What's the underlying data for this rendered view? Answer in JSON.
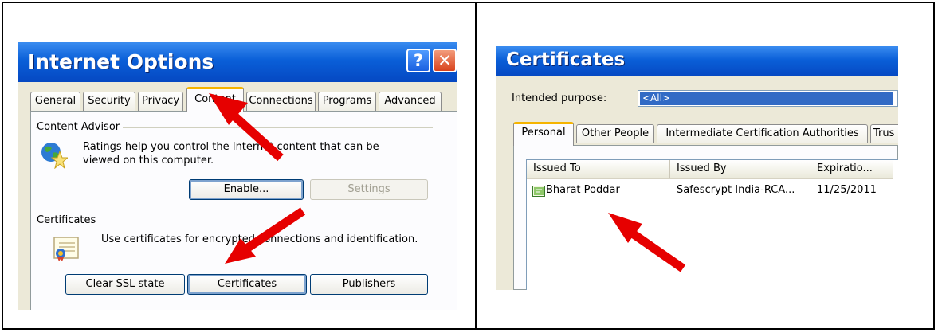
{
  "internet_options": {
    "title": "Internet Options",
    "help_glyph": "?",
    "close_glyph": "✕",
    "tabs": [
      "General",
      "Security",
      "Privacy",
      "Content",
      "Connections",
      "Programs",
      "Advanced"
    ],
    "active_tab": "Content",
    "content_advisor": {
      "group_label": "Content Advisor",
      "description_line1": "Ratings help you control the Internet content that can be",
      "description_line2": "viewed on this computer.",
      "enable_button": "Enable...",
      "settings_button": "Settings"
    },
    "certificates": {
      "group_label": "Certificates",
      "description": "Use certificates for encrypted connections and identification.",
      "clear_ssl_button": "Clear SSL state",
      "certificates_button": "Certificates",
      "publishers_button": "Publishers"
    }
  },
  "certificates_dialog": {
    "title": "Certificates",
    "intended_purpose_label": "Intended purpose:",
    "intended_purpose_value": "<All>",
    "tabs": [
      "Personal",
      "Other People",
      "Intermediate Certification Authorities",
      "Trus"
    ],
    "active_tab": "Personal",
    "columns": [
      "Issued To",
      "Issued By",
      "Expiratio..."
    ],
    "rows": [
      {
        "issued_to": "Bharat Poddar",
        "issued_by": "Safescrypt India-RCA...",
        "expiration": "11/25/2011"
      }
    ]
  },
  "colors": {
    "titlebar": "#0a5fd8",
    "dialog_bg": "#ece9d8",
    "arrow": "#e60000",
    "active_tab_accent": "#f5b400"
  }
}
